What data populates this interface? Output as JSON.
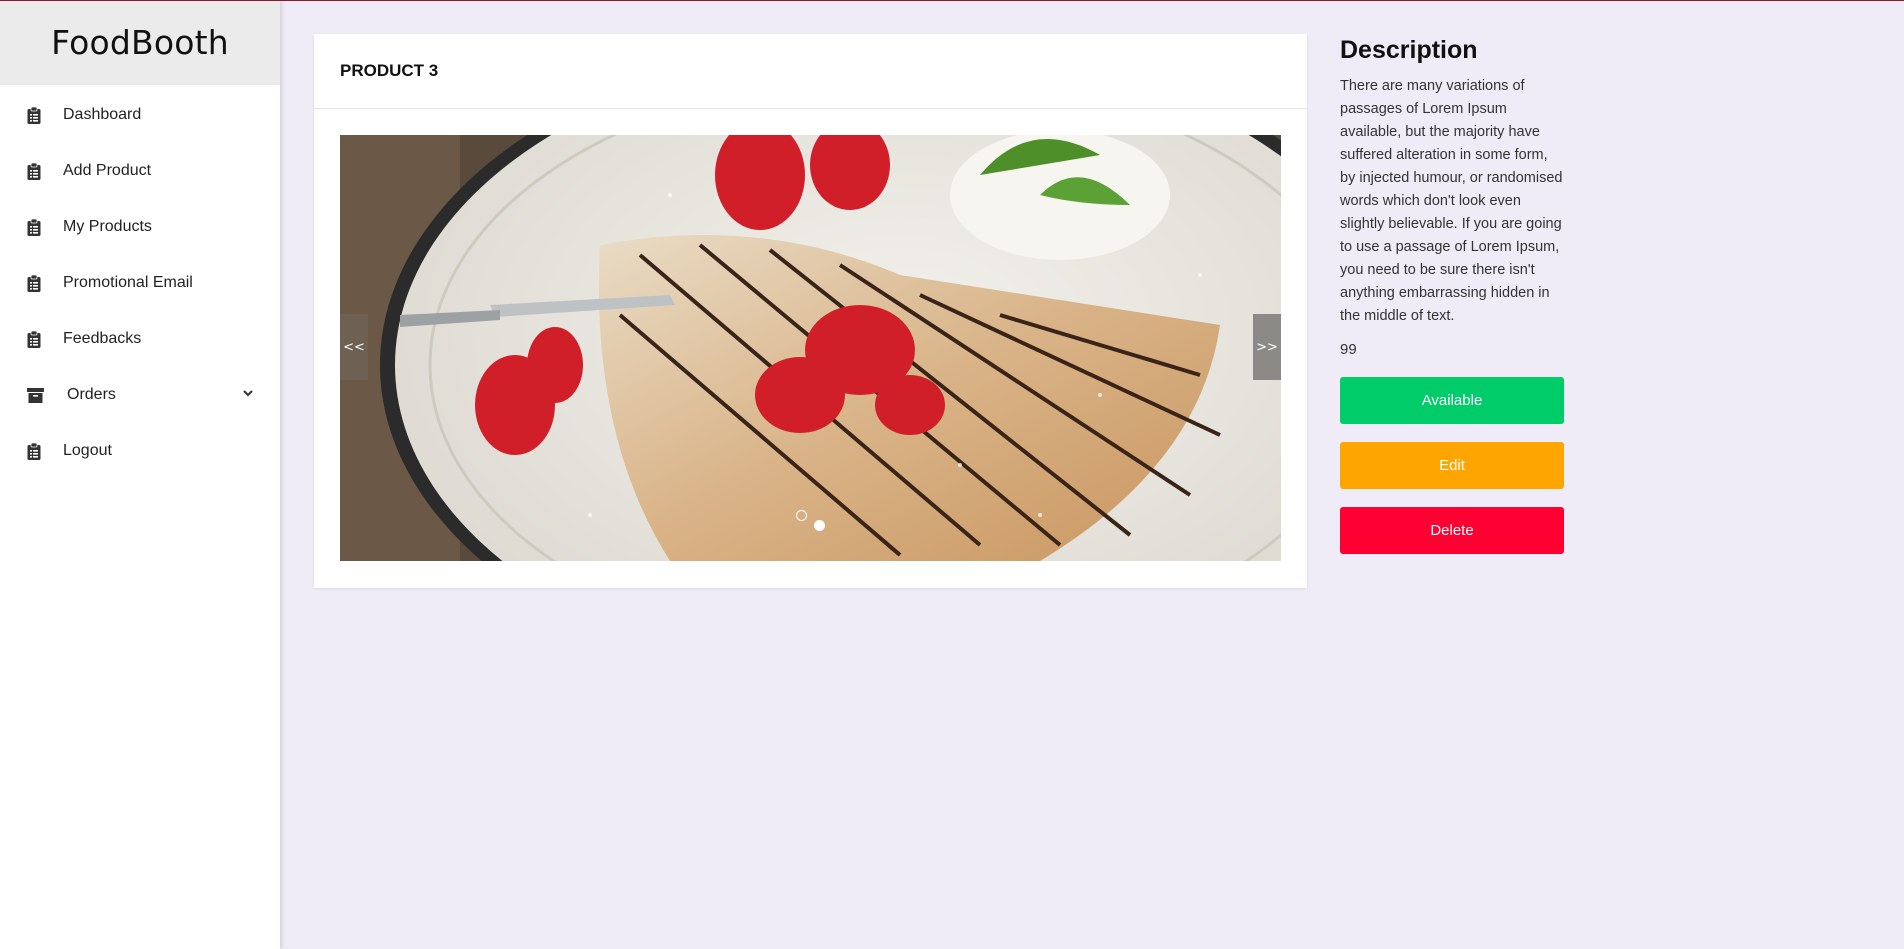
{
  "app": {
    "brand": "FoodBooth"
  },
  "sidebar": {
    "items": [
      {
        "label": "Dashboard",
        "icon": "clipboard-icon"
      },
      {
        "label": "Add Product",
        "icon": "clipboard-icon"
      },
      {
        "label": "My Products",
        "icon": "clipboard-icon"
      },
      {
        "label": "Promotional Email",
        "icon": "clipboard-icon"
      },
      {
        "label": "Feedbacks",
        "icon": "clipboard-icon"
      },
      {
        "label": "Orders",
        "icon": "archive-icon",
        "expandable": true
      },
      {
        "label": "Logout",
        "icon": "clipboard-icon"
      }
    ]
  },
  "product": {
    "title": "PRODUCT 3",
    "carousel": {
      "prev_label": "<<",
      "next_label": ">>",
      "slide_count": 2,
      "active_slide": 1
    }
  },
  "description": {
    "heading": "Description",
    "text": "There are many variations of passages of Lorem Ipsum available, but the majority have suffered alteration in some form, by injected humour, or randomised words which don't look even slightly believable. If you are going to use a passage of Lorem Ipsum, you need to be sure there isn't anything embarrassing hidden in the middle of text.",
    "price": "99"
  },
  "actions": {
    "available_label": "Available",
    "edit_label": "Edit",
    "delete_label": "Delete"
  },
  "colors": {
    "available": "#00cc6a",
    "edit": "#ffa500",
    "delete": "#ff0033",
    "background": "#efecf7"
  }
}
